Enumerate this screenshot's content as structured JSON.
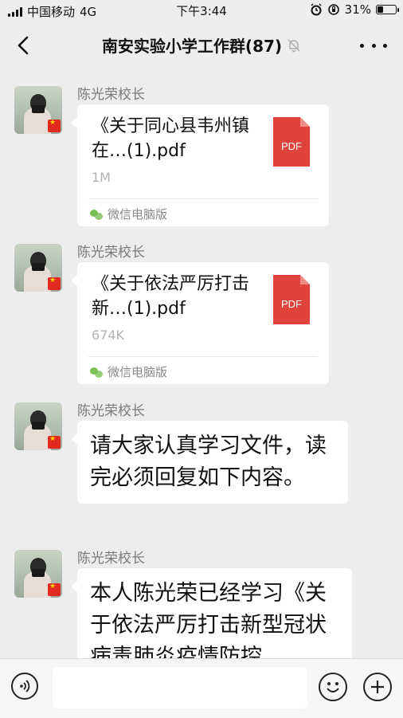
{
  "status_bar": {
    "carrier": "中国移动",
    "network": "4G",
    "time": "下午3:44",
    "battery": "31%",
    "battery_level": 0.31
  },
  "header": {
    "title": "南安实验小学工作群(87)",
    "icons": [
      "back-arrow-icon",
      "mute-bell-icon",
      "more-icon"
    ]
  },
  "messages": [
    {
      "type": "file",
      "sender": "陈光荣校长",
      "file_name": "《关于同心县韦州镇在…(1).pdf",
      "file_size": "1M",
      "file_icon_label": "PDF",
      "source": "微信电脑版"
    },
    {
      "type": "file",
      "sender": "陈光荣校长",
      "file_name": "《关于依法严厉打击新…(1).pdf",
      "file_size": "674K",
      "file_icon_label": "PDF",
      "source": "微信电脑版"
    },
    {
      "type": "text",
      "sender": "陈光荣校长",
      "text": "请大家认真学习文件，读完必须回复如下内容。"
    },
    {
      "type": "text",
      "sender": "陈光荣校长",
      "text": "本人陈光荣已经学习《关于依法严厉打击新型冠状病毒肺炎疫情防控"
    }
  ],
  "input_bar": {
    "value": "",
    "icons": [
      "voice-icon",
      "emoji-icon",
      "plus-icon"
    ]
  },
  "colors": {
    "background": "#ededed",
    "bubble": "#ffffff",
    "pdf_red": "#e0433c",
    "secondary_text": "#7a7a7a"
  }
}
